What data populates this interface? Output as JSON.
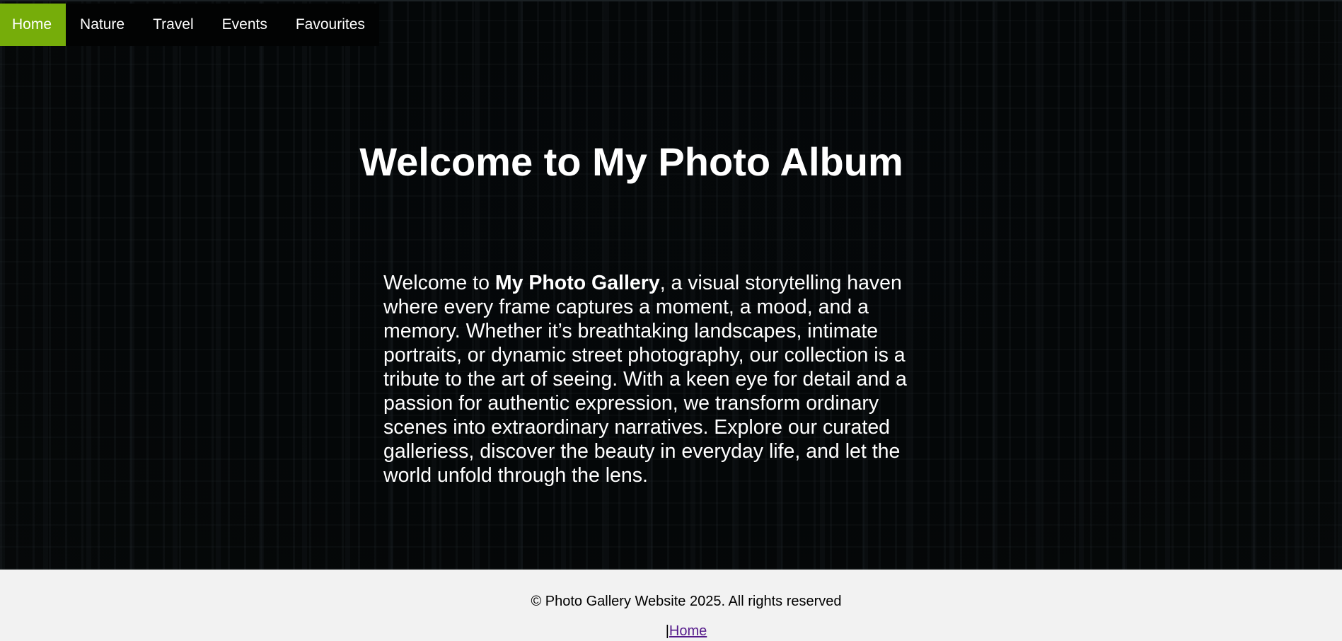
{
  "nav": {
    "items": [
      {
        "label": "Home",
        "active": true
      },
      {
        "label": "Nature",
        "active": false
      },
      {
        "label": "Travel",
        "active": false
      },
      {
        "label": "Events",
        "active": false
      },
      {
        "label": "Favourites",
        "active": false
      }
    ],
    "active_color": "#76ad0a"
  },
  "hero": {
    "title": "Welcome to My Photo Album",
    "intro_prefix": "Welcome to ",
    "intro_bold": "My Photo Gallery",
    "intro_rest": ", a visual storytelling haven where every frame captures a moment, a mood, and a memory. Whether it’s breathtaking landscapes, intimate portraits, or dynamic street photography, our collection is a tribute to the art of seeing. With a keen eye for detail and a passion for authentic expression, we transform ordinary scenes into extraordinary narratives. Explore our curated galleriess, discover the beauty in everyday life, and let the world unfold through the lens."
  },
  "footer": {
    "copyright": "© Photo Gallery Website 2025. All rights reserved",
    "separator": "|",
    "home_link": "Home",
    "link_color": "#551a8b"
  }
}
